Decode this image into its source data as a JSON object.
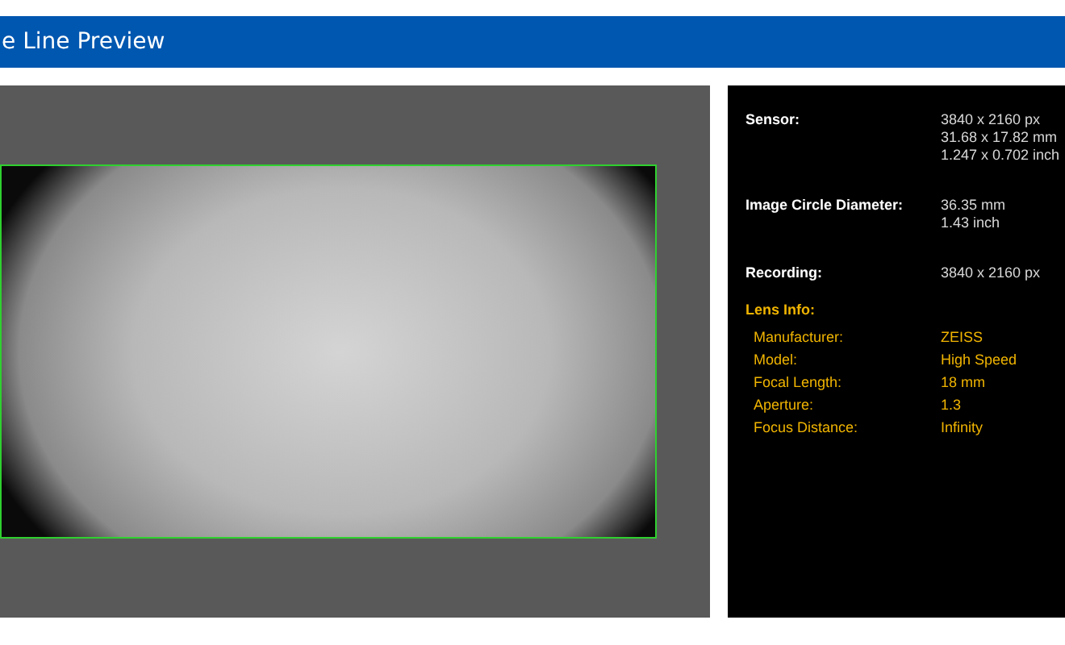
{
  "header": {
    "title": "e Line Preview"
  },
  "specs": [
    {
      "label": "Sensor:",
      "values": [
        "3840 x 2160 px",
        "31.68 x 17.82 mm",
        "1.247 x 0.702 inch"
      ]
    },
    {
      "label": "Image Circle Diameter:",
      "values": [
        "36.35 mm",
        "1.43 inch"
      ]
    },
    {
      "label": "Recording:",
      "values": [
        "3840 x 2160 px"
      ]
    }
  ],
  "lens_info": {
    "title": "Lens Info:",
    "rows": [
      {
        "label": "Manufacturer:",
        "value": "ZEISS"
      },
      {
        "label": "Model:",
        "value": "High Speed"
      },
      {
        "label": "Focal Length:",
        "value": "18 mm"
      },
      {
        "label": "Aperture:",
        "value": "1.3"
      },
      {
        "label": "Focus Distance:",
        "value": "Infinity"
      }
    ]
  }
}
